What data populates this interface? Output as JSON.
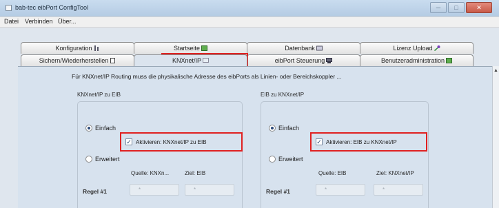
{
  "window": {
    "title": "bab-tec eibPort ConfigTool"
  },
  "menu": {
    "items": [
      "Datei",
      "Verbinden",
      "Über..."
    ]
  },
  "tabs": {
    "row1": [
      "Konfiguration",
      "Startseite",
      "Datenbank",
      "Lizenz Upload"
    ],
    "row2": [
      "Sichern/Wiederherstellen",
      "KNXnet/IP",
      "eibPort Steuerung",
      "Benutzeradministration"
    ]
  },
  "main": {
    "description": "Für KNXnet/IP Routing muss die physikalische Adresse des eibPorts als Linien- oder Bereichskoppler ...",
    "left": {
      "title": "KNXnet/IP zu EIB",
      "simple": "Einfach",
      "checkbox": "Aktivieren: KNXnet/IP zu EIB",
      "extended": "Erweitert",
      "source_col": "Quelle: KNXn...",
      "target_col": "Ziel: EIB",
      "rule_label": "Regel #1",
      "field1": "*",
      "field2": "*"
    },
    "right": {
      "title": "EIB zu KNXnet/IP",
      "simple": "Einfach",
      "checkbox": "Aktivieren: EIB zu KNXnet/IP",
      "extended": "Erweitert",
      "source_col": "Quelle: EIB",
      "target_col": "Ziel: KNXnet/IP",
      "rule_label": "Regel #1",
      "field1": "*",
      "field2": "*"
    }
  },
  "colors": {
    "highlight": "#e02020",
    "panel": "#d7e2ee"
  }
}
